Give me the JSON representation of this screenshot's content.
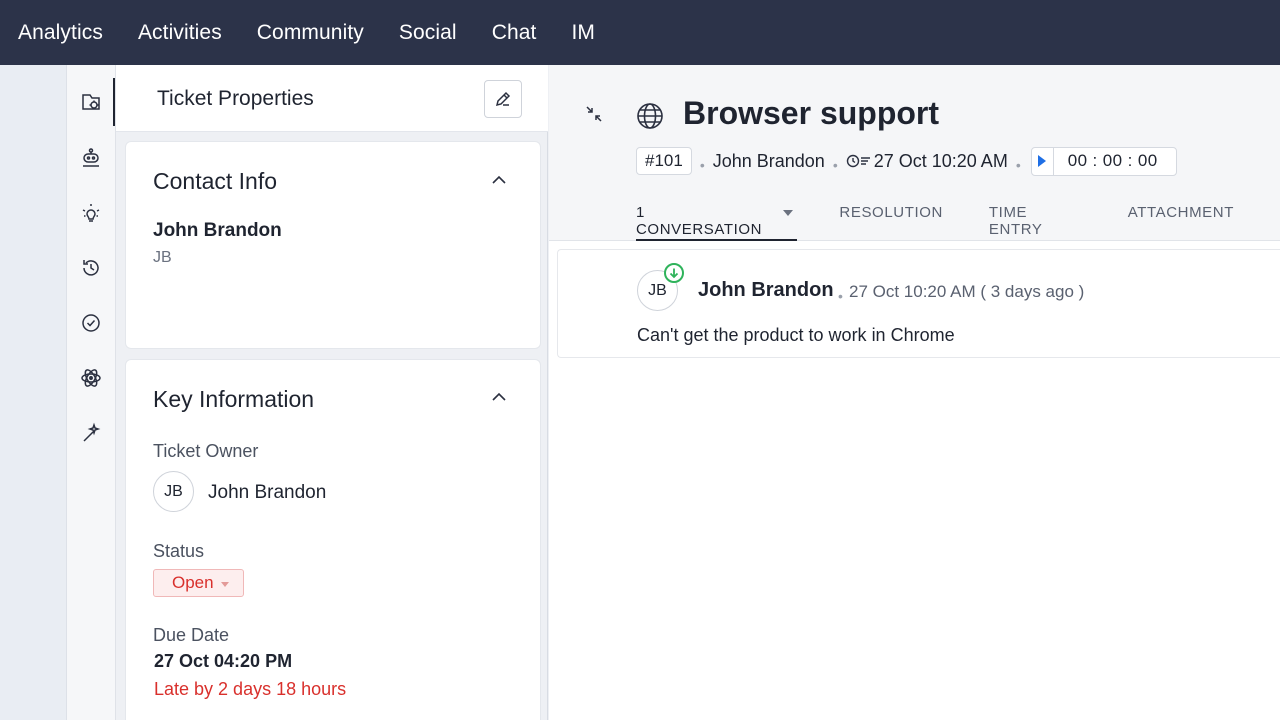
{
  "topnav": {
    "items": [
      "Analytics",
      "Activities",
      "Community",
      "Social",
      "Chat",
      "IM"
    ]
  },
  "rail": {
    "icons": [
      "ticket-properties-icon",
      "bot-icon",
      "bulb-icon",
      "history-icon",
      "check-circle-icon",
      "atom-icon",
      "magic-wand-icon"
    ]
  },
  "properties": {
    "title": "Ticket Properties",
    "contact": {
      "section_title": "Contact Info",
      "name": "John Brandon",
      "initials": "JB"
    },
    "key_info": {
      "section_title": "Key Information",
      "owner_label": "Ticket Owner",
      "owner_initials": "JB",
      "owner_name": "John Brandon",
      "status_label": "Status",
      "status_value": "Open",
      "due_label": "Due Date",
      "due_value": "27 Oct 04:20 PM",
      "late_text": "Late by 2 days 18 hours"
    }
  },
  "ticket": {
    "title": "Browser support",
    "number": "#101",
    "contact": "John Brandon",
    "created": "27 Oct 10:20 AM",
    "timer": "00 : 00 : 00",
    "tabs": [
      "1 CONVERSATION",
      "RESOLUTION",
      "TIME ENTRY",
      "ATTACHMENT"
    ],
    "thread": {
      "initials": "JB",
      "author": "John Brandon",
      "time": "27 Oct 10:20 AM ( 3 days ago )",
      "body": "Can't get the product to work in Chrome"
    }
  },
  "colors": {
    "nav_bg": "#2c3349",
    "danger": "#d9302c",
    "accent": "#1f6fe5",
    "incoming": "#2fb35b"
  }
}
